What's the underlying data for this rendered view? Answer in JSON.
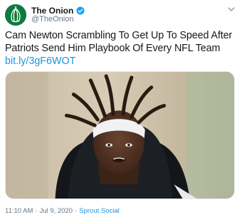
{
  "account": {
    "display_name": "The Onion",
    "handle": "@TheOnion",
    "avatar_icon": "onion-logo-icon",
    "verified_icon": "verified-badge-icon"
  },
  "tweet": {
    "text": "Cam Newton Scrambling To Get Up To Speed After Patriots Send Him Playbook Of Every NFL Team",
    "link": "bit.ly/3gF6WOT",
    "media_icon": "photo-football-player"
  },
  "meta": {
    "time": "11:10 AM",
    "separator": "·",
    "date": "Jul 9, 2020",
    "source": "Sprout Social"
  },
  "menu_icon": "chevron-down-icon",
  "colors": {
    "link": "#1b95e0",
    "secondary_text": "#657786",
    "verified": "#1da1f2",
    "brand": "#0f7a3f"
  }
}
